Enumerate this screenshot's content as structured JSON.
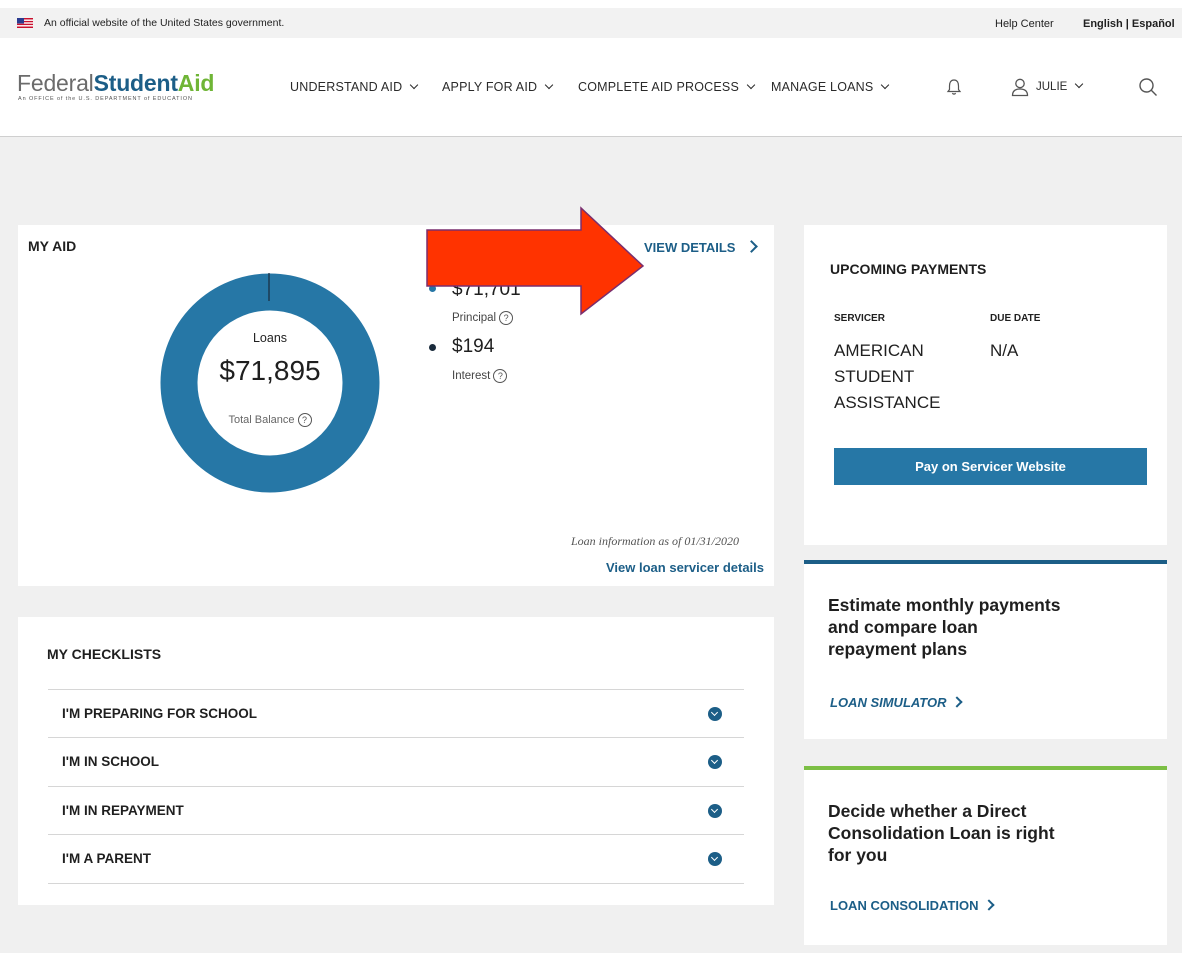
{
  "gov_banner": {
    "text": "An official website of the United States government.",
    "help_center": "Help Center",
    "language": "English | Español"
  },
  "header": {
    "logo_federal": "Federal",
    "logo_student": "Student",
    "logo_aid": "Aid",
    "logo_sub": "An OFFICE of the U.S. DEPARTMENT of EDUCATION",
    "nav": [
      {
        "label": "UNDERSTAND AID"
      },
      {
        "label": "APPLY FOR AID"
      },
      {
        "label": "COMPLETE AID PROCESS"
      },
      {
        "label": "MANAGE LOANS"
      }
    ],
    "user_name": "JULIE"
  },
  "my_aid": {
    "title": "MY AID",
    "view_details": "VIEW DETAILS",
    "center_label": "Loans",
    "total": "$71,895",
    "total_label": "Total Balance",
    "principal_amount": "$71,701",
    "principal_label": "Principal",
    "interest_amount": "$194",
    "interest_label": "Interest",
    "as_of": "Loan information as of 01/31/2020",
    "servicer_link": "View loan servicer details"
  },
  "checklists": {
    "title": "MY CHECKLISTS",
    "items": [
      {
        "label": "I'M PREPARING FOR SCHOOL"
      },
      {
        "label": "I'M IN SCHOOL"
      },
      {
        "label": "I'M IN REPAYMENT"
      },
      {
        "label": "I'M A PARENT"
      }
    ]
  },
  "upcoming": {
    "title": "UPCOMING PAYMENTS",
    "servicer_header": "SERVICER",
    "due_header": "DUE DATE",
    "servicer_name": "AMERICAN STUDENT ASSISTANCE",
    "due_date": "N/A",
    "pay_button": "Pay on Servicer Website"
  },
  "simulator": {
    "text": "Estimate monthly payments and compare loan repayment plans",
    "link": "LOAN SIMULATOR"
  },
  "consolidation": {
    "text": "Decide whether a Direct Consolidation Loan is right for you",
    "link": "LOAN CONSOLIDATION"
  },
  "colors": {
    "brand_blue": "#1c5e87",
    "donut_blue": "#2677a6",
    "brand_green": "#7cbf45",
    "arrow_red": "#ff3300"
  }
}
